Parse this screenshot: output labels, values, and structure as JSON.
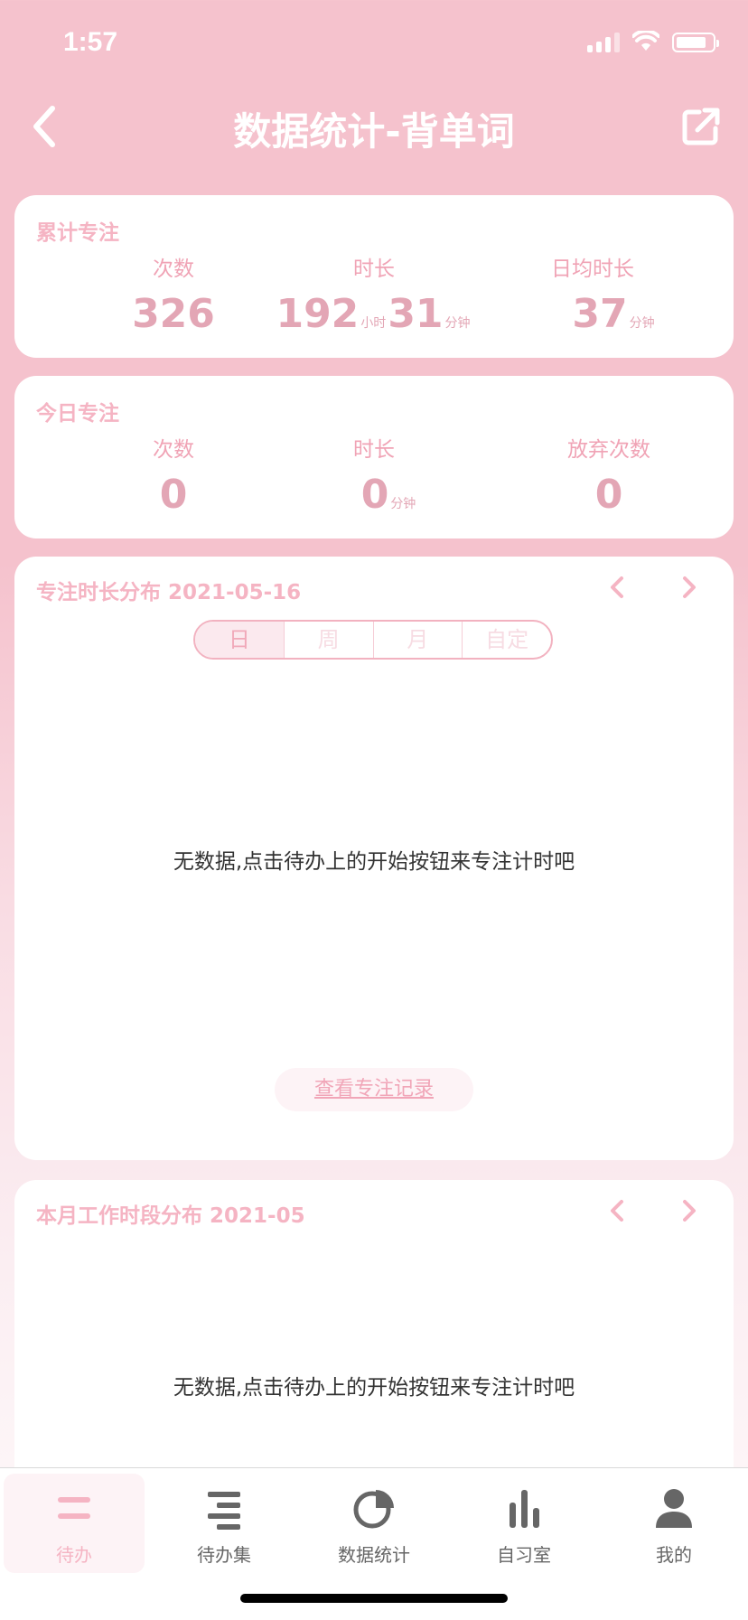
{
  "status": {
    "time": "1:57"
  },
  "nav": {
    "title": "数据统计-背单词"
  },
  "total": {
    "label": "累计专注",
    "count_head": "次数",
    "count": "326",
    "duration_head": "时长",
    "hours": "192",
    "hours_unit": "小时",
    "minutes": "31",
    "minutes_unit": "分钟",
    "avg_head": "日均时长",
    "avg": "37",
    "avg_unit": "分钟"
  },
  "today": {
    "label": "今日专注",
    "count_head": "次数",
    "count": "0",
    "duration_head": "时长",
    "duration": "0",
    "duration_unit": "分钟",
    "giveup_head": "放弃次数",
    "giveup": "0"
  },
  "distribution": {
    "title": "专注时长分布 2021-05-16",
    "tabs": [
      "日",
      "周",
      "月",
      "自定"
    ],
    "empty": "无数据,点击待办上的开始按钮来专注计时吧",
    "record_link": "查看专注记录"
  },
  "monthly": {
    "title": "本月工作时段分布  2021-05",
    "empty": "无数据,点击待办上的开始按钮来专注计时吧"
  },
  "tabbar": {
    "items": [
      {
        "label": "待办",
        "icon": "todo-icon"
      },
      {
        "label": "待办集",
        "icon": "todo-set-icon"
      },
      {
        "label": "数据统计",
        "icon": "pie-chart-icon"
      },
      {
        "label": "自习室",
        "icon": "bar-chart-icon"
      },
      {
        "label": "我的",
        "icon": "user-icon"
      }
    ]
  },
  "colors": {
    "accent": "#f5c2cd",
    "accent_text": "#f5b4c3",
    "value_text": "#e3a6b5"
  }
}
